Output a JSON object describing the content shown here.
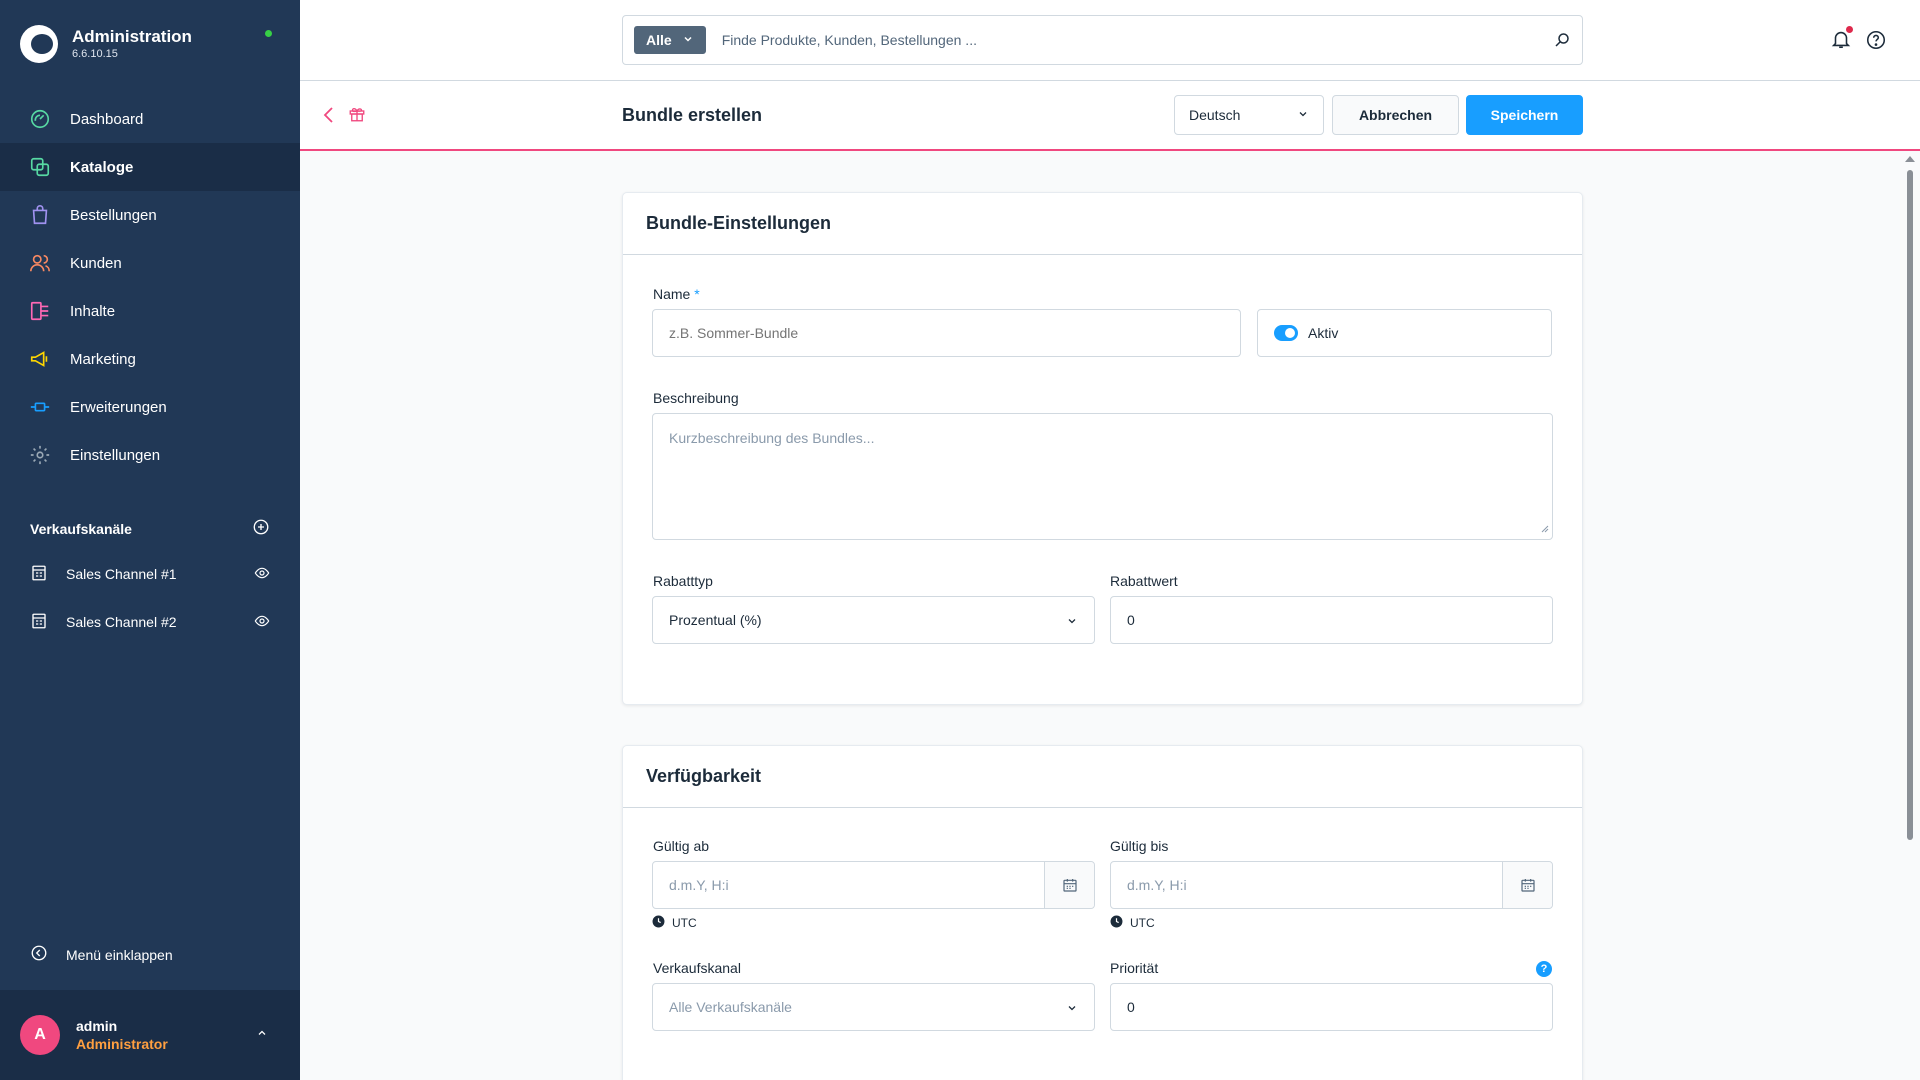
{
  "app": {
    "title": "Administration",
    "version": "6.6.10.15"
  },
  "nav": {
    "items": [
      {
        "label": "Dashboard",
        "icon": "dashboard-icon",
        "color": "#57d9a3"
      },
      {
        "label": "Kataloge",
        "icon": "catalog-icon",
        "color": "#57d9a3",
        "active": true
      },
      {
        "label": "Bestellungen",
        "icon": "orders-icon",
        "color": "#a092f0"
      },
      {
        "label": "Kunden",
        "icon": "customers-icon",
        "color": "#f88962"
      },
      {
        "label": "Inhalte",
        "icon": "content-icon",
        "color": "#ff68b4"
      },
      {
        "label": "Marketing",
        "icon": "marketing-icon",
        "color": "#ffd700"
      },
      {
        "label": "Erweiterungen",
        "icon": "extensions-icon",
        "color": "#189eff"
      },
      {
        "label": "Einstellungen",
        "icon": "settings-icon",
        "color": "#9aa8b5"
      }
    ]
  },
  "sales_channels": {
    "heading": "Verkaufskanäle",
    "items": [
      {
        "label": "Sales Channel #1"
      },
      {
        "label": "Sales Channel #2"
      }
    ]
  },
  "collapse_label": "Menü einklappen",
  "user": {
    "initial": "A",
    "name": "admin",
    "role": "Administrator"
  },
  "search": {
    "type": "Alle",
    "placeholder": "Finde Produkte, Kunden, Bestellungen ..."
  },
  "header": {
    "title": "Bundle erstellen",
    "language": "Deutsch",
    "cancel_label": "Abbrechen",
    "save_label": "Speichern"
  },
  "bundle_settings": {
    "title": "Bundle-Einstellungen",
    "name_label": "Name",
    "name_required": "*",
    "name_placeholder": "z.B. Sommer-Bundle",
    "active_label": "Aktiv",
    "active": true,
    "description_label": "Beschreibung",
    "description_placeholder": "Kurzbeschreibung des Bundles...",
    "discount_type_label": "Rabatttyp",
    "discount_type_value": "Prozentual (%)",
    "discount_value_label": "Rabattwert",
    "discount_value": "0"
  },
  "availability": {
    "title": "Verfügbarkeit",
    "valid_from_label": "Gültig ab",
    "valid_from_placeholder": "d.m.Y, H:i",
    "valid_to_label": "Gültig bis",
    "valid_to_placeholder": "d.m.Y, H:i",
    "timezone": "UTC",
    "channel_label": "Verkaufskanal",
    "channel_placeholder": "Alle Verkaufskanäle",
    "priority_label": "Priorität",
    "priority_value": "0",
    "priority_help": "?"
  },
  "colors": {
    "accent": "#189eff",
    "sidebar": "#213856",
    "header_line": "#f0487f"
  }
}
